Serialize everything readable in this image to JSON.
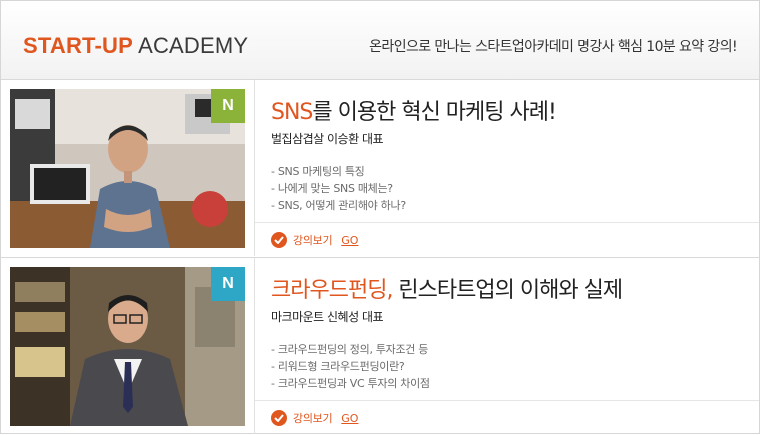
{
  "header": {
    "brand_accent": "START-UP",
    "brand_rest": "ACADEMY",
    "tagline": "온라인으로 만나는 스타트업아카데미 명강사 핵심 10분 요약 강의!"
  },
  "lectures": [
    {
      "badge": "N",
      "badge_color": "#8bb33a",
      "title_highlight": "SNS",
      "title_rest": "를 이용한 혁신 마케팅 사례!",
      "speaker": "벌집삼겹살 이승환 대표",
      "points": [
        "- SNS 마케팅의 특징",
        "- 나에게 맞는 SNS 매체는?",
        "- SNS, 어떻게 관리해야 하나?"
      ],
      "watch_label": "강의보기",
      "go_label": "GO"
    },
    {
      "badge": "N",
      "badge_color": "#2ea7c6",
      "title_highlight": "크라우드펀딩,",
      "title_rest": " 린스타트업의 이해와 실제",
      "speaker": "마크마운트 신혜성 대표",
      "points": [
        "- 크라우드펀딩의 정의, 투자조건 등",
        "- 리워드형 크라우드펀딩이란?",
        "- 크라우드펀딩과 VC 투자의 차이점"
      ],
      "watch_label": "강의보기",
      "go_label": "GO"
    }
  ],
  "colors": {
    "accent": "#e0561f",
    "text": "#222222",
    "muted": "#6a6a6a"
  }
}
